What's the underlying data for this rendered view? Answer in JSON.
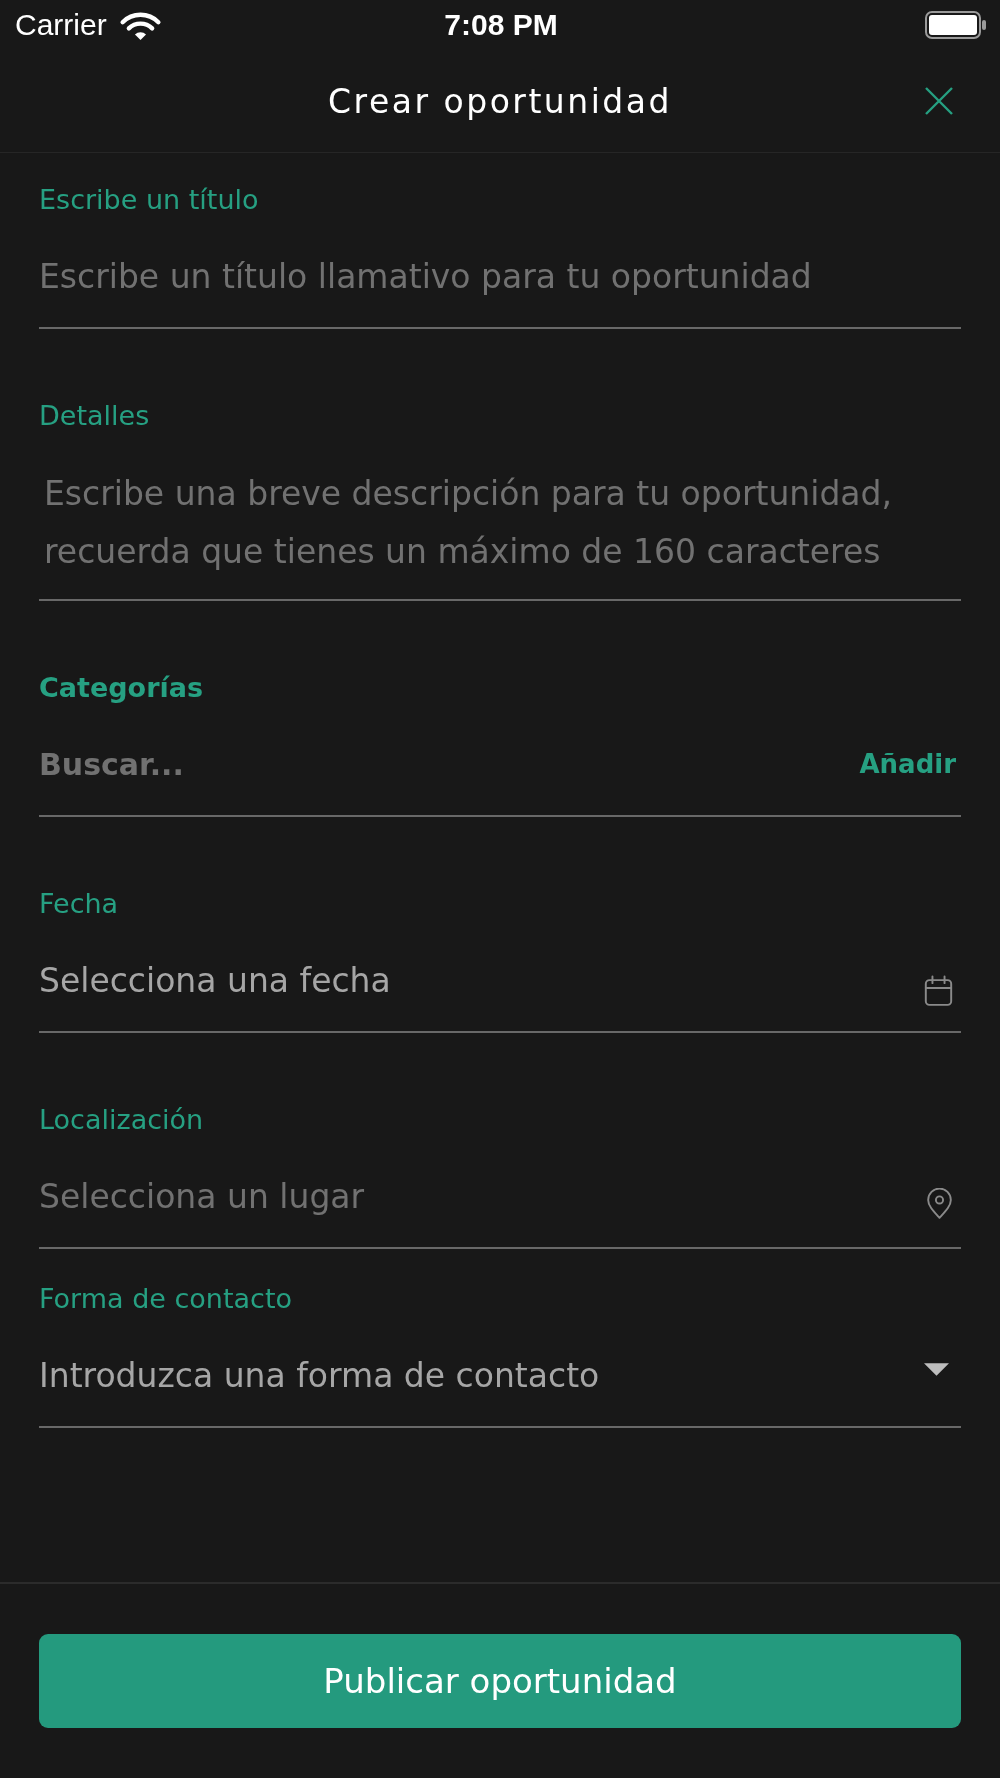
{
  "status_bar": {
    "carrier": "Carrier",
    "time": "7:08 PM"
  },
  "header": {
    "title": "Crear oportunidad"
  },
  "fields": [
    {
      "kind": "text",
      "label": "Escribe un título",
      "placeholder": "Escribe un título llamativo para tu oportunidad"
    },
    {
      "kind": "textarea",
      "label": "Detalles",
      "placeholder": "Escribe una breve descripción para tu oportunidad, recuerda que tienes un máximo de 160 caracteres"
    },
    {
      "kind": "search",
      "label": "Categorías",
      "placeholder": "Buscar...",
      "action": "Añadir"
    },
    {
      "kind": "date",
      "label": "Fecha",
      "placeholder": "Selecciona una fecha"
    },
    {
      "kind": "location",
      "label": "Localización",
      "placeholder": "Selecciona un lugar"
    },
    {
      "kind": "select",
      "label": "Forma de contacto",
      "placeholder": "Introduzca una forma de contacto"
    }
  ],
  "submit_button": "Publicar oportunidad"
}
